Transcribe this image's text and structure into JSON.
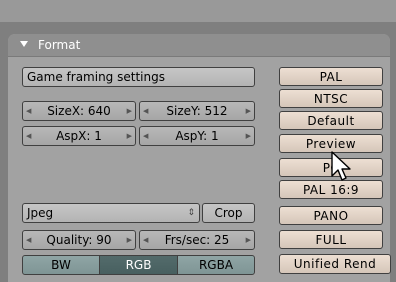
{
  "panel": {
    "title": "Format"
  },
  "framing": {
    "label": "Game framing settings"
  },
  "size": {
    "x_label": "SizeX: 640",
    "y_label": "SizeY: 512"
  },
  "aspect": {
    "x_label": "AspX: 1",
    "y_label": "AspY: 1"
  },
  "format": {
    "value": "Jpeg",
    "crop_label": "Crop"
  },
  "quality": {
    "label": "Quality: 90"
  },
  "fps": {
    "label": "Frs/sec: 25"
  },
  "color_modes": [
    {
      "label": "BW",
      "selected": false
    },
    {
      "label": "RGB",
      "selected": true
    },
    {
      "label": "RGBA",
      "selected": false
    }
  ],
  "presets": [
    "PAL",
    "NTSC",
    "Default",
    "Preview",
    "PC",
    "PAL 16:9",
    "PANO",
    "FULL",
    "Unified Rend"
  ],
  "colors": {
    "panel_bg": "#a2a2a2",
    "preset_bg": "#e3d5c9",
    "toggle_selected": "#4d6666"
  }
}
